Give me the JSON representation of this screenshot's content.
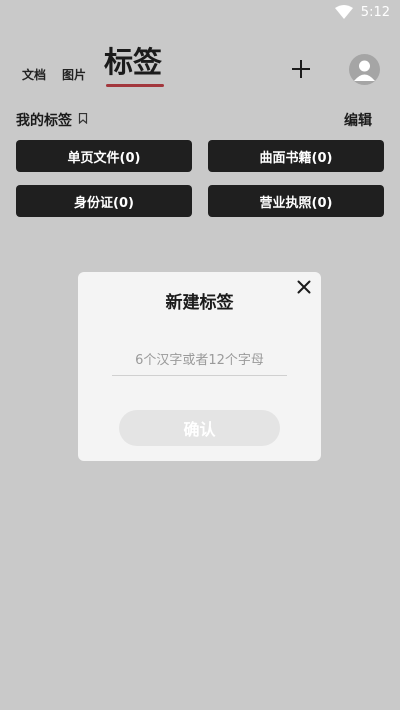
{
  "status_bar": {
    "time": "5:12",
    "icons": [
      "wifi-icon",
      "battery-icon"
    ]
  },
  "tabs": {
    "docs": "文档",
    "images": "图片",
    "active": "标签",
    "underline_color": "#a3373d"
  },
  "header": {
    "add_icon": "plus-icon",
    "avatar_icon": "user-avatar-icon"
  },
  "section": {
    "title": "我的标签",
    "flag_icon": "bookmark-flag-icon",
    "edit": "编辑"
  },
  "tags": [
    {
      "label": "单页文件(0)"
    },
    {
      "label": "曲面书籍(0)"
    },
    {
      "label": "身份证(0)"
    },
    {
      "label": "营业执照(0)"
    }
  ],
  "dialog": {
    "title": "新建标签",
    "close_icon": "close-icon",
    "input_placeholder": "6个汉字或者12个字母",
    "input_value": "",
    "confirm": "确认"
  },
  "colors": {
    "background": "#c9c9c9",
    "tag_bg": "#1f1f1f",
    "dialog_bg": "#f4f4f4",
    "confirm_bg": "#e4e4e4"
  }
}
